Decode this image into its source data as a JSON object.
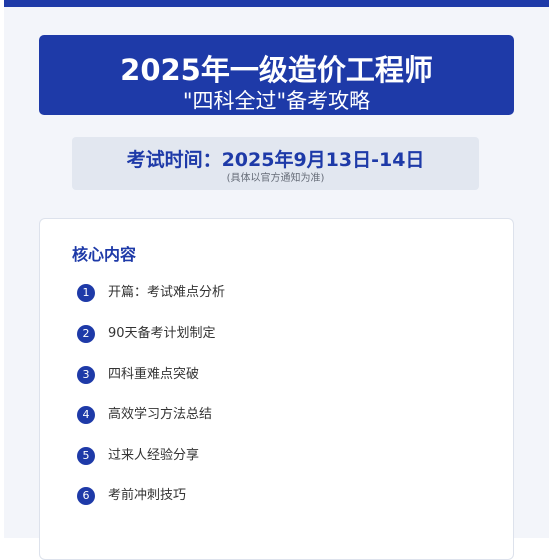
{
  "banner": {
    "title": "2025年一级造价工程师",
    "subtitle": "\"四科全过\"备考攻略"
  },
  "exam": {
    "time_text": "考试时间：2025年9月13日-14日",
    "note": "(具体以官方通知为准)"
  },
  "core": {
    "heading": "核心内容",
    "items": [
      {
        "num": "1",
        "label": "开篇：考试难点分析"
      },
      {
        "num": "2",
        "label": "90天备考计划制定"
      },
      {
        "num": "3",
        "label": "四科重难点突破"
      },
      {
        "num": "4",
        "label": "高效学习方法总结"
      },
      {
        "num": "5",
        "label": "过来人经验分享"
      },
      {
        "num": "6",
        "label": "考前冲刺技巧"
      }
    ]
  },
  "colors": {
    "accent": "#1e3aa8",
    "page_background": "#f3f5fa",
    "exam_box_background": "#e2e7f0"
  }
}
